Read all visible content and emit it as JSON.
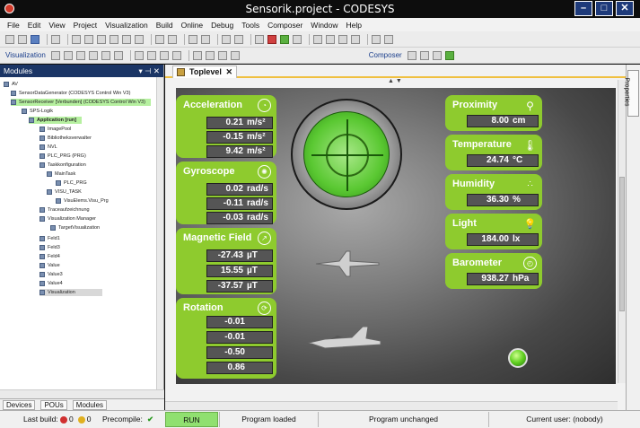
{
  "window": {
    "title": "Sensorik.project - CODESYS"
  },
  "menu": [
    "File",
    "Edit",
    "View",
    "Project",
    "Visualization",
    "Build",
    "Online",
    "Debug",
    "Tools",
    "Composer",
    "Window",
    "Help"
  ],
  "toolbar2": {
    "left_label": "Visualization",
    "right_label": "Composer"
  },
  "modules": {
    "title": "Modules",
    "tree": [
      "AV",
      "SensorDataGenerator (CODESYS Control Win V3)",
      "SensorReceiver [Verbunden] (CODESYS Control Win V3)",
      "SPS-Logik",
      "Application [run]",
      "ImagePool",
      "Bibliotheksverwalter",
      "NVL",
      "PLC_PRG (PRG)",
      "Taskkonfiguration",
      "MainTask",
      "PLC_PRG",
      "VISU_TASK",
      "VisuElems.Visu_Prg",
      "Traceaufzeichnung",
      "Visualization Manager",
      "TargetVisualization",
      "Feld1",
      "Feld3",
      "Feld4",
      "Value",
      "Value3",
      "Value4",
      "Visualization"
    ],
    "tabs": [
      "Devices",
      "POUs",
      "Modules"
    ]
  },
  "editor": {
    "tab": "Toplevel"
  },
  "cards": {
    "acceleration": {
      "title": "Acceleration",
      "rows": [
        {
          "v": "0.21",
          "u": "m/s²"
        },
        {
          "v": "-0.15",
          "u": "m/s²"
        },
        {
          "v": "9.42",
          "u": "m/s²"
        }
      ]
    },
    "gyroscope": {
      "title": "Gyroscope",
      "rows": [
        {
          "v": "0.02",
          "u": "rad/s"
        },
        {
          "v": "-0.11",
          "u": "rad/s"
        },
        {
          "v": "-0.03",
          "u": "rad/s"
        }
      ]
    },
    "magnetic": {
      "title": "Magnetic Field",
      "rows": [
        {
          "v": "-27.43",
          "u": "µT"
        },
        {
          "v": "15.55",
          "u": "µT"
        },
        {
          "v": "-37.57",
          "u": "µT"
        }
      ]
    },
    "rotation": {
      "title": "Rotation",
      "rows": [
        "-0.01",
        "-0.01",
        "-0.50",
        "0.86"
      ]
    },
    "proximity": {
      "title": "Proximity",
      "v": "8.00",
      "u": "cm"
    },
    "temperature": {
      "title": "Temperature",
      "v": "24.74",
      "u": "°C"
    },
    "humidity": {
      "title": "Humidity",
      "v": "36.30",
      "u": "%"
    },
    "light": {
      "title": "Light",
      "v": "184.00",
      "u": "lx"
    },
    "barometer": {
      "title": "Barometer",
      "v": "938.27",
      "u": "hPa"
    }
  },
  "properties_tab": "Properties",
  "status": {
    "last_build_label": "Last build:",
    "errors": "0",
    "warnings": "0",
    "precompile_label": "Precompile:",
    "run": "RUN",
    "program_loaded": "Program loaded",
    "program_unchanged": "Program unchanged",
    "current_user": "Current user: (nobody)"
  }
}
